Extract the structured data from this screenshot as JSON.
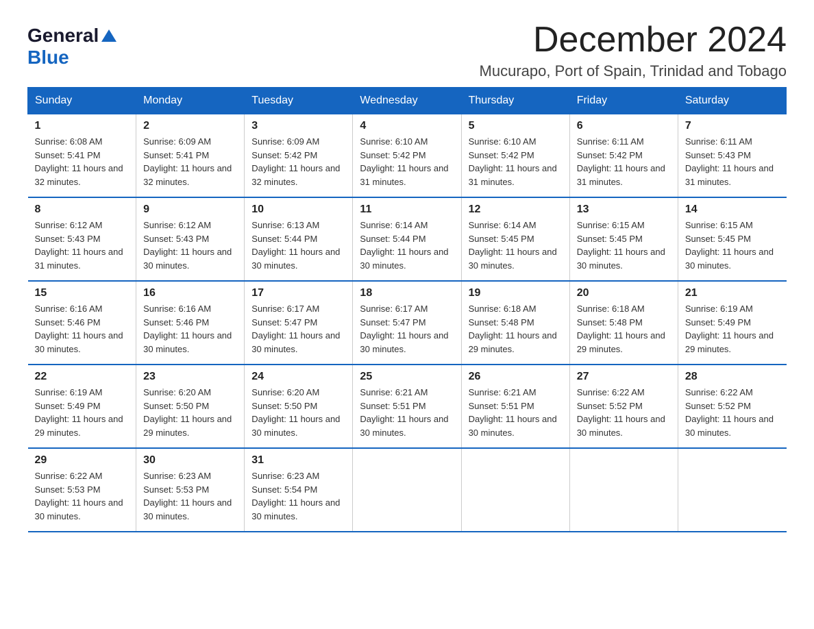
{
  "logo": {
    "general": "General",
    "blue": "Blue",
    "triangle": "▲"
  },
  "title": "December 2024",
  "subtitle": "Mucurapo, Port of Spain, Trinidad and Tobago",
  "days_of_week": [
    "Sunday",
    "Monday",
    "Tuesday",
    "Wednesday",
    "Thursday",
    "Friday",
    "Saturday"
  ],
  "weeks": [
    [
      {
        "day": "1",
        "sunrise": "6:08 AM",
        "sunset": "5:41 PM",
        "daylight": "11 hours and 32 minutes."
      },
      {
        "day": "2",
        "sunrise": "6:09 AM",
        "sunset": "5:41 PM",
        "daylight": "11 hours and 32 minutes."
      },
      {
        "day": "3",
        "sunrise": "6:09 AM",
        "sunset": "5:42 PM",
        "daylight": "11 hours and 32 minutes."
      },
      {
        "day": "4",
        "sunrise": "6:10 AM",
        "sunset": "5:42 PM",
        "daylight": "11 hours and 31 minutes."
      },
      {
        "day": "5",
        "sunrise": "6:10 AM",
        "sunset": "5:42 PM",
        "daylight": "11 hours and 31 minutes."
      },
      {
        "day": "6",
        "sunrise": "6:11 AM",
        "sunset": "5:42 PM",
        "daylight": "11 hours and 31 minutes."
      },
      {
        "day": "7",
        "sunrise": "6:11 AM",
        "sunset": "5:43 PM",
        "daylight": "11 hours and 31 minutes."
      }
    ],
    [
      {
        "day": "8",
        "sunrise": "6:12 AM",
        "sunset": "5:43 PM",
        "daylight": "11 hours and 31 minutes."
      },
      {
        "day": "9",
        "sunrise": "6:12 AM",
        "sunset": "5:43 PM",
        "daylight": "11 hours and 30 minutes."
      },
      {
        "day": "10",
        "sunrise": "6:13 AM",
        "sunset": "5:44 PM",
        "daylight": "11 hours and 30 minutes."
      },
      {
        "day": "11",
        "sunrise": "6:14 AM",
        "sunset": "5:44 PM",
        "daylight": "11 hours and 30 minutes."
      },
      {
        "day": "12",
        "sunrise": "6:14 AM",
        "sunset": "5:45 PM",
        "daylight": "11 hours and 30 minutes."
      },
      {
        "day": "13",
        "sunrise": "6:15 AM",
        "sunset": "5:45 PM",
        "daylight": "11 hours and 30 minutes."
      },
      {
        "day": "14",
        "sunrise": "6:15 AM",
        "sunset": "5:45 PM",
        "daylight": "11 hours and 30 minutes."
      }
    ],
    [
      {
        "day": "15",
        "sunrise": "6:16 AM",
        "sunset": "5:46 PM",
        "daylight": "11 hours and 30 minutes."
      },
      {
        "day": "16",
        "sunrise": "6:16 AM",
        "sunset": "5:46 PM",
        "daylight": "11 hours and 30 minutes."
      },
      {
        "day": "17",
        "sunrise": "6:17 AM",
        "sunset": "5:47 PM",
        "daylight": "11 hours and 30 minutes."
      },
      {
        "day": "18",
        "sunrise": "6:17 AM",
        "sunset": "5:47 PM",
        "daylight": "11 hours and 30 minutes."
      },
      {
        "day": "19",
        "sunrise": "6:18 AM",
        "sunset": "5:48 PM",
        "daylight": "11 hours and 29 minutes."
      },
      {
        "day": "20",
        "sunrise": "6:18 AM",
        "sunset": "5:48 PM",
        "daylight": "11 hours and 29 minutes."
      },
      {
        "day": "21",
        "sunrise": "6:19 AM",
        "sunset": "5:49 PM",
        "daylight": "11 hours and 29 minutes."
      }
    ],
    [
      {
        "day": "22",
        "sunrise": "6:19 AM",
        "sunset": "5:49 PM",
        "daylight": "11 hours and 29 minutes."
      },
      {
        "day": "23",
        "sunrise": "6:20 AM",
        "sunset": "5:50 PM",
        "daylight": "11 hours and 29 minutes."
      },
      {
        "day": "24",
        "sunrise": "6:20 AM",
        "sunset": "5:50 PM",
        "daylight": "11 hours and 30 minutes."
      },
      {
        "day": "25",
        "sunrise": "6:21 AM",
        "sunset": "5:51 PM",
        "daylight": "11 hours and 30 minutes."
      },
      {
        "day": "26",
        "sunrise": "6:21 AM",
        "sunset": "5:51 PM",
        "daylight": "11 hours and 30 minutes."
      },
      {
        "day": "27",
        "sunrise": "6:22 AM",
        "sunset": "5:52 PM",
        "daylight": "11 hours and 30 minutes."
      },
      {
        "day": "28",
        "sunrise": "6:22 AM",
        "sunset": "5:52 PM",
        "daylight": "11 hours and 30 minutes."
      }
    ],
    [
      {
        "day": "29",
        "sunrise": "6:22 AM",
        "sunset": "5:53 PM",
        "daylight": "11 hours and 30 minutes."
      },
      {
        "day": "30",
        "sunrise": "6:23 AM",
        "sunset": "5:53 PM",
        "daylight": "11 hours and 30 minutes."
      },
      {
        "day": "31",
        "sunrise": "6:23 AM",
        "sunset": "5:54 PM",
        "daylight": "11 hours and 30 minutes."
      },
      null,
      null,
      null,
      null
    ]
  ]
}
